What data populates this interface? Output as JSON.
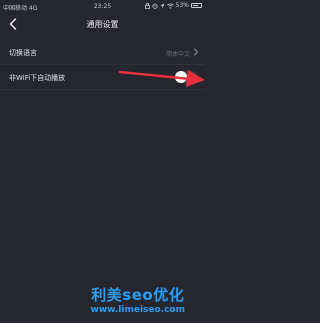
{
  "status_bar": {
    "carrier": "中国移动 4G",
    "time": "23:25",
    "battery_percent": "53%",
    "icons": [
      "lock-icon",
      "alarm-icon",
      "location-icon",
      "wifi-icon",
      "battery-icon"
    ]
  },
  "nav": {
    "back_icon": "chevron-left-icon",
    "title": "通用设置"
  },
  "settings": [
    {
      "label": "切换语言",
      "value": "简体中文",
      "control": "chevron-right-icon"
    },
    {
      "label": "非WiFi下自动播放",
      "control": "toggle",
      "toggle_on": false
    }
  ],
  "annotation": {
    "arrow_color": "#e8303d"
  },
  "watermark": {
    "title": "利美seo优化",
    "url": "www.limeiseo.com",
    "color": "#2a9df4"
  },
  "colors": {
    "background": "#25262e",
    "text": "#e9e9ee",
    "muted": "#6f707a"
  }
}
